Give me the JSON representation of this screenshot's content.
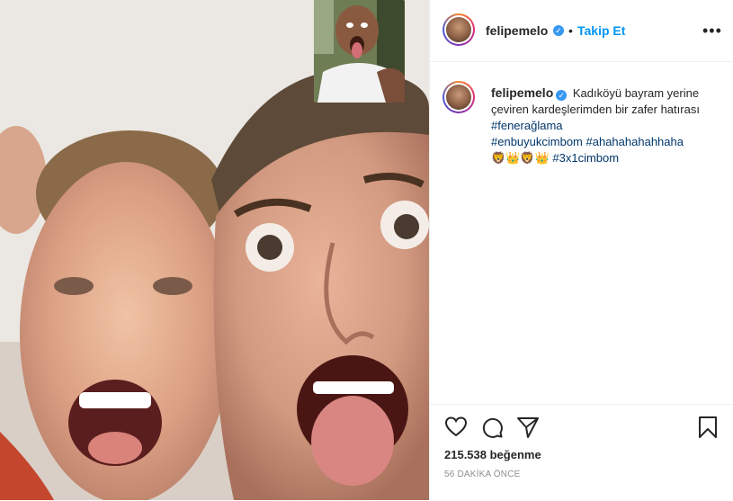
{
  "post": {
    "username": "felipemelo",
    "verified_symbol": "✓",
    "dot": "•",
    "follow_label": "Takip Et",
    "more_icon": "more-options-icon",
    "caption": {
      "text": "Kadıköyü bayram yerine çeviren kardeşlerimden bir zafer hatırası",
      "hashtags": [
        "#fenerağlama",
        "#enbuyukcimbom",
        "#ahahahahahhaha",
        "#3x1cimbom"
      ],
      "emojis": [
        "🦁",
        "👑",
        "🦁",
        "👑"
      ]
    },
    "likes_text": "215.538 beğenme",
    "time_text": "56 DAKİKA ÖNCE",
    "icons": [
      "heart-icon",
      "comment-icon",
      "share-icon",
      "bookmark-icon"
    ]
  },
  "media": {
    "description_icon": "photo-image",
    "pip_icon": "video-call-thumbnail"
  },
  "colors": {
    "link": "#0095f6",
    "hashtag": "#00376b",
    "verified": "#3897f0",
    "muted": "#8e8e8e",
    "divider": "#efefef"
  }
}
